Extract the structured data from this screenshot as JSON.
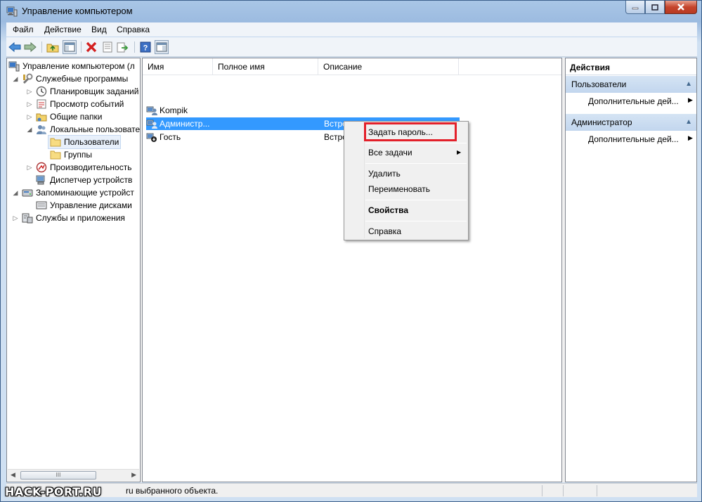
{
  "window": {
    "title": "Управление компьютером"
  },
  "menu": [
    "Файл",
    "Действие",
    "Вид",
    "Справка"
  ],
  "toolbar": {
    "icons": [
      "back-arrow-icon",
      "forward-arrow-icon",
      "up-folder-icon",
      "show-hide-tree-icon",
      "delete-icon",
      "properties-icon",
      "export-list-icon",
      "help-icon",
      "show-hide-action-pane-icon"
    ]
  },
  "tree": {
    "items": [
      {
        "label": "Управление компьютером (л",
        "level": 0,
        "expander": "",
        "icon": "computer-management-icon"
      },
      {
        "label": "Служебные программы",
        "level": 1,
        "expander": "◢",
        "icon": "tools-icon"
      },
      {
        "label": "Планировщик заданий",
        "level": 2,
        "expander": "▷",
        "icon": "clock-icon"
      },
      {
        "label": "Просмотр событий",
        "level": 2,
        "expander": "▷",
        "icon": "event-viewer-icon"
      },
      {
        "label": "Общие папки",
        "level": 2,
        "expander": "▷",
        "icon": "shared-folder-icon"
      },
      {
        "label": "Локальные пользовате",
        "level": 2,
        "expander": "◢",
        "icon": "local-users-icon"
      },
      {
        "label": "Пользователи",
        "level": 3,
        "expander": "",
        "icon": "folder-icon"
      },
      {
        "label": "Группы",
        "level": 3,
        "expander": "",
        "icon": "folder-icon"
      },
      {
        "label": "Производительность",
        "level": 2,
        "expander": "▷",
        "icon": "performance-icon"
      },
      {
        "label": "Диспетчер устройств",
        "level": 2,
        "expander": "",
        "icon": "device-manager-icon"
      },
      {
        "label": "Запоминающие устройст",
        "level": 1,
        "expander": "◢",
        "icon": "storage-icon"
      },
      {
        "label": "Управление дисками",
        "level": 2,
        "expander": "",
        "icon": "disk-icon"
      },
      {
        "label": "Службы и приложения",
        "level": 1,
        "expander": "▷",
        "icon": "services-icon"
      }
    ],
    "selected": "Пользователи",
    "scrollbar_grip": "III"
  },
  "list": {
    "columns": [
      "Имя",
      "Полное имя",
      "Описание"
    ],
    "rows": [
      {
        "name": "Kompik",
        "full_name": "",
        "description": "",
        "icon": "user-icon"
      },
      {
        "name": "Администр...",
        "full_name": "",
        "description": "Встро",
        "icon": "user-icon",
        "selected": true
      },
      {
        "name": "Гость",
        "full_name": "",
        "description": "Встро",
        "icon": "guest-user-icon"
      }
    ]
  },
  "context_menu": {
    "set_password": "Задать пароль...",
    "all_tasks": "Все задачи",
    "delete": "Удалить",
    "rename": "Переименовать",
    "properties": "Свойства",
    "help": "Справка",
    "highlight_color": "#e3202a"
  },
  "actions": {
    "title": "Действия",
    "sections": [
      {
        "label": "Пользователи",
        "item": "Дополнительные дей..."
      },
      {
        "label": "Администратор",
        "item": "Дополнительные дей..."
      }
    ]
  },
  "status": {
    "text": "ru выбранного объекта."
  },
  "watermark": "HACK-PORT.RU",
  "colors": {
    "selection": "#3399ff",
    "window_frame": "#9cbbe0",
    "close_button": "#c5452d"
  }
}
